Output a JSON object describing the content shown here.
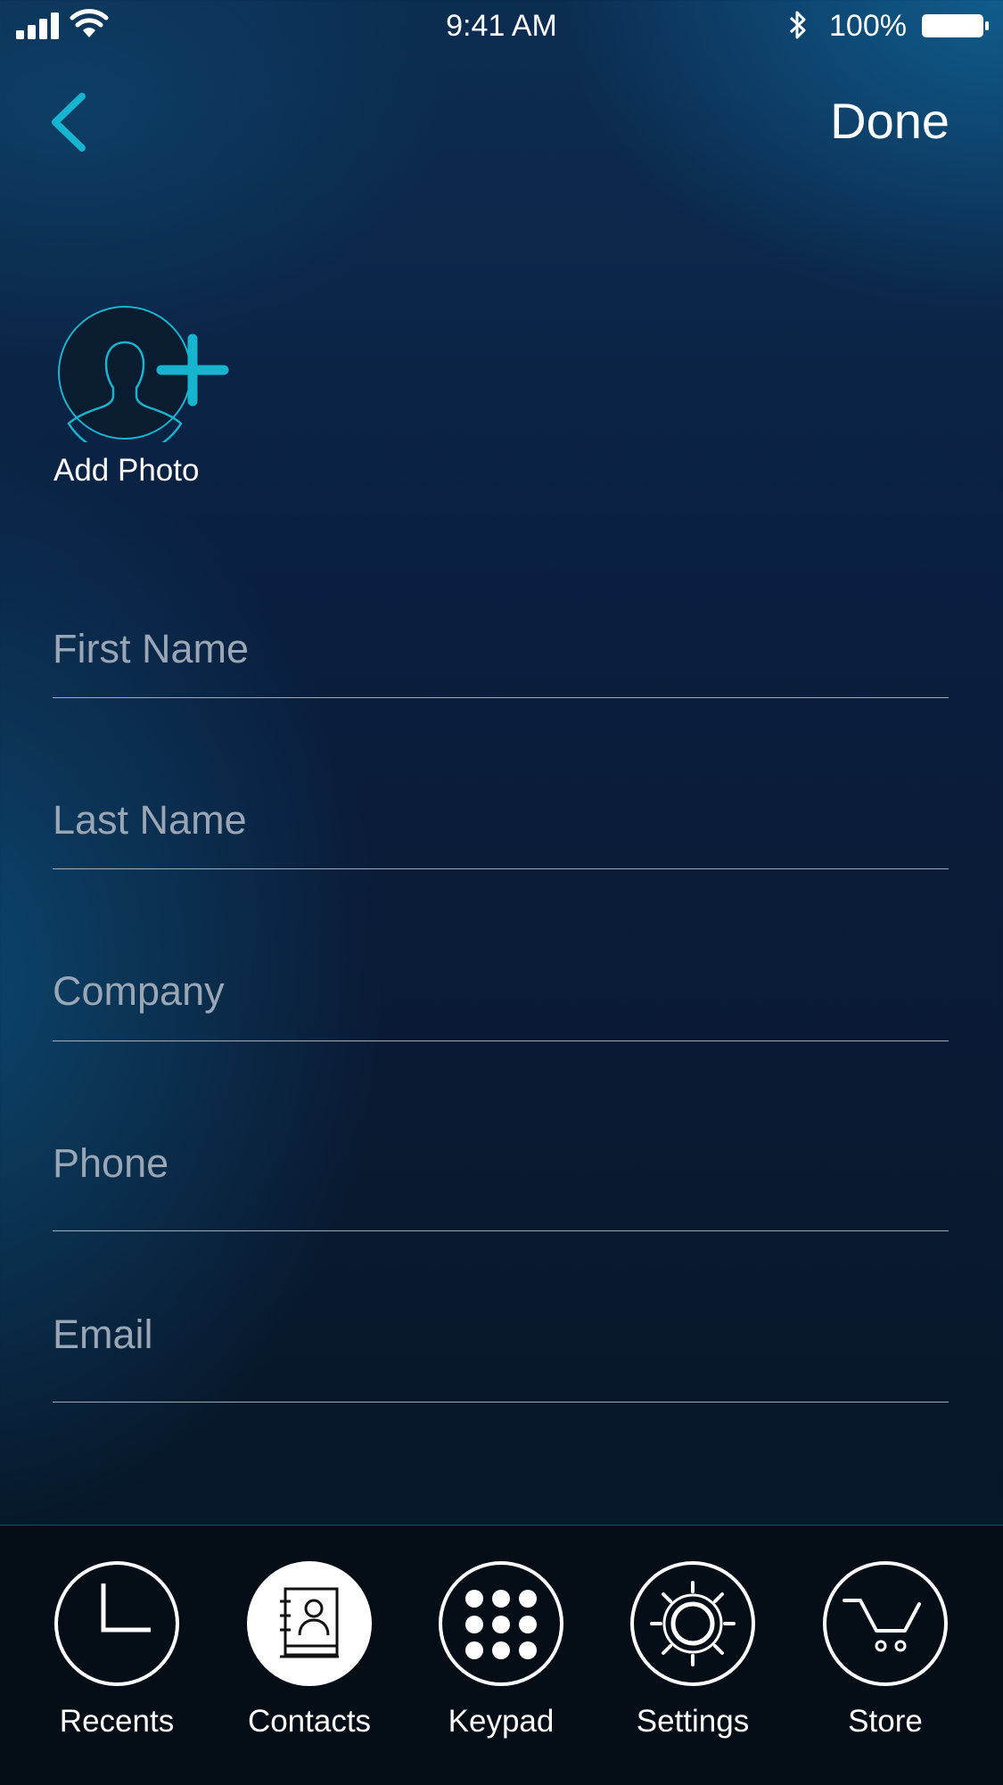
{
  "status_bar": {
    "time": "9:41 AM",
    "battery_percent": "100%",
    "icons": [
      "signal-icon",
      "wifi-icon",
      "bluetooth-icon",
      "battery-icon"
    ]
  },
  "header": {
    "back_icon": "chevron-left-icon",
    "done_label": "Done"
  },
  "photo": {
    "label": "Add Photo",
    "icon": "person-silhouette-icon",
    "add_icon": "plus-icon"
  },
  "form": {
    "first_name": {
      "placeholder": "First Name",
      "value": ""
    },
    "last_name": {
      "placeholder": "Last Name",
      "value": ""
    },
    "company": {
      "placeholder": "Company",
      "value": ""
    },
    "phone": {
      "placeholder": "Phone",
      "value": ""
    },
    "email": {
      "placeholder": "Email",
      "value": ""
    }
  },
  "tabbar": {
    "active": "Contacts",
    "items": [
      {
        "label": "Recents",
        "icon": "clock-icon"
      },
      {
        "label": "Contacts",
        "icon": "contacts-book-icon"
      },
      {
        "label": "Keypad",
        "icon": "keypad-icon"
      },
      {
        "label": "Settings",
        "icon": "gear-icon"
      },
      {
        "label": "Store",
        "icon": "cart-icon"
      }
    ]
  },
  "colors": {
    "accent": "#16b4cf",
    "placeholder": "#9aa6b4",
    "background_top": "#0c2d52",
    "background_bottom": "#050f1c",
    "tabbar_bg": "#050d16"
  }
}
